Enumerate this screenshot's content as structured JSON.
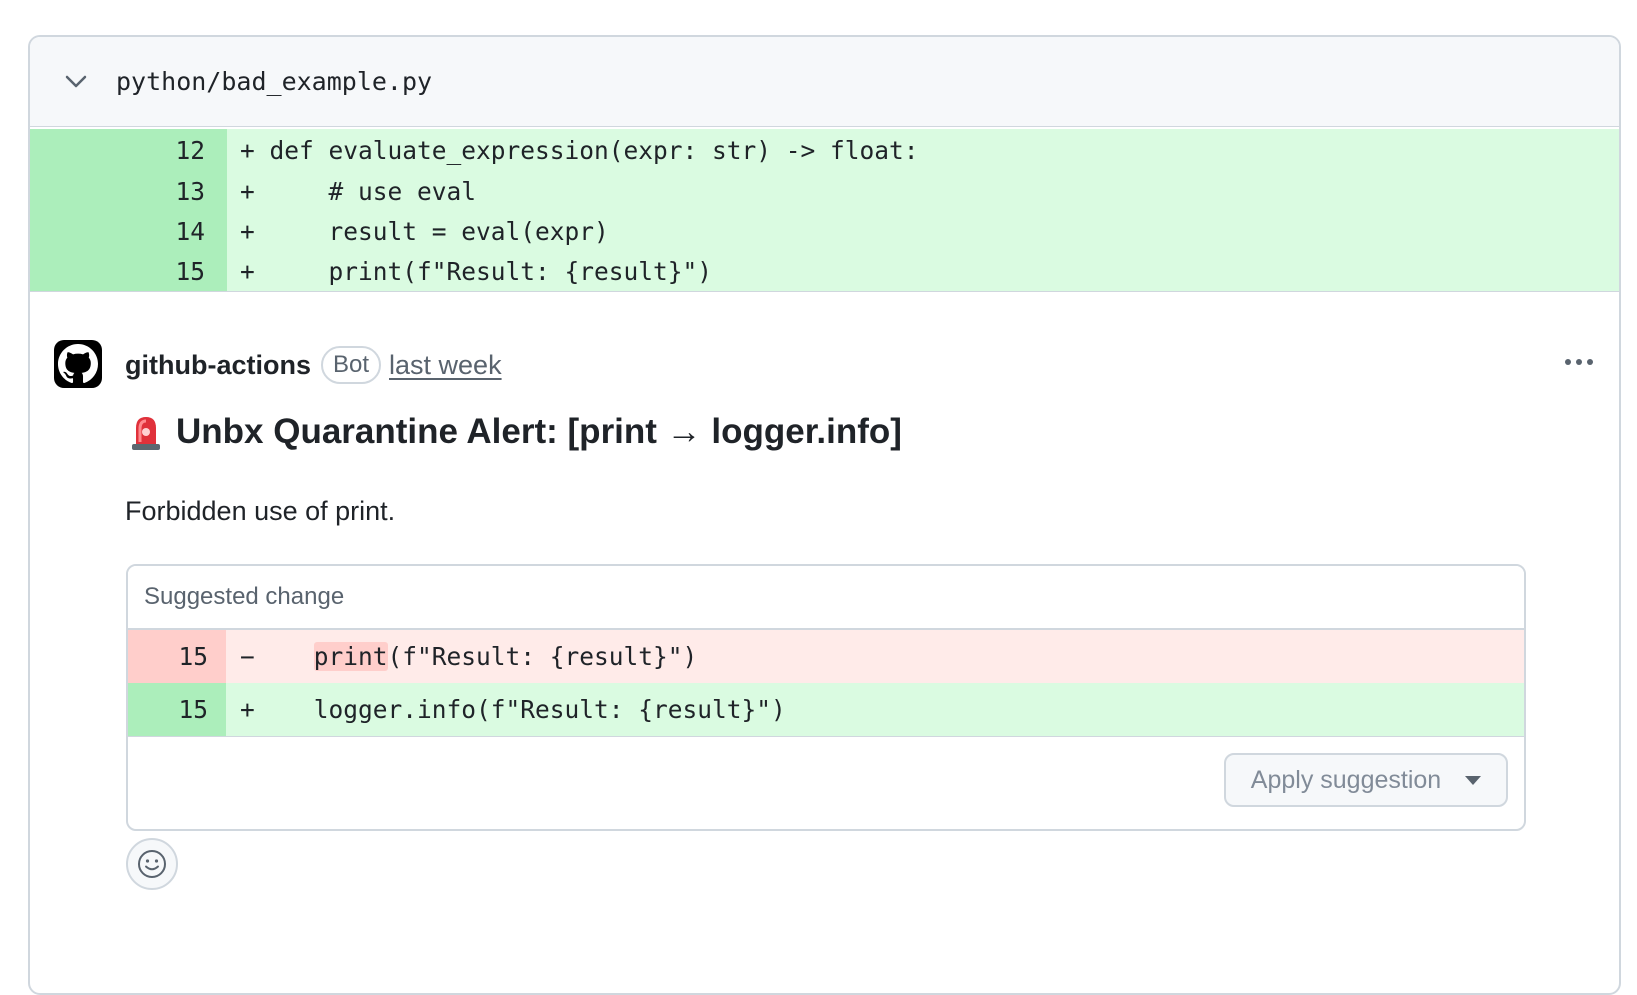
{
  "file": {
    "name": "python/bad_example.py",
    "lines": [
      {
        "num": "12",
        "text": "+ def evaluate_expression(expr: str) -> float:"
      },
      {
        "num": "13",
        "text": "+     # use eval"
      },
      {
        "num": "14",
        "text": "+     result = eval(expr)"
      },
      {
        "num": "15",
        "text": "+     print(f\"Result: {result}\")"
      }
    ]
  },
  "comment": {
    "author": "github-actions",
    "badge": "Bot",
    "time": "last week",
    "title": "Unbx Quarantine Alert: [print → logger.info]",
    "body": "Forbidden use of print.",
    "suggestion": {
      "header": "Suggested change",
      "deleted": {
        "num": "15",
        "sign": "−",
        "indent": "    ",
        "highlight": "print",
        "rest": "(f\"Result: {result}\")"
      },
      "added": {
        "num": "15",
        "sign": "+",
        "text": "    logger.info(f\"Result: {result}\")"
      },
      "apply_label": "Apply suggestion"
    }
  },
  "colors": {
    "add_line_bg": "#dafbe1",
    "add_num_bg": "#aceebb",
    "del_line_bg": "#ffebe9",
    "del_num_bg": "#ffcecb"
  },
  "icons": [
    "chevron-down-icon",
    "github-octocat-icon",
    "kebab-menu-icon",
    "siren-emoji-icon",
    "caret-down-icon",
    "smiley-icon"
  ]
}
